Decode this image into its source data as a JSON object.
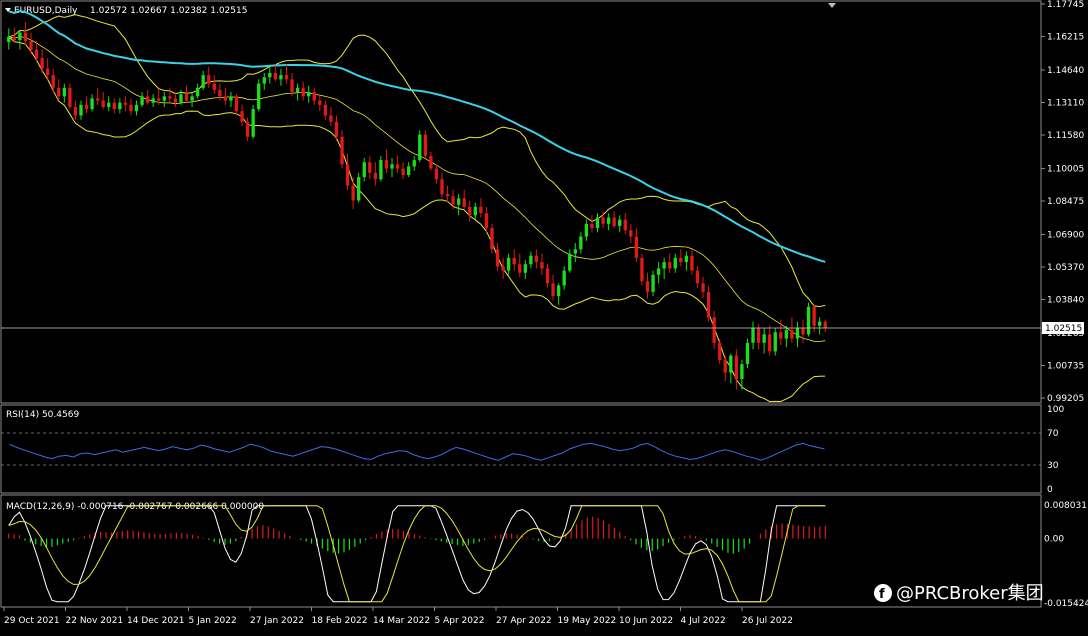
{
  "main_panel": {
    "symbol_title": "EURUSD,Daily",
    "ohlc": "1.02572 1.02667 1.02382 1.02515",
    "current_price_label": "1.02515",
    "price_axis_labels": [
      "1.17745",
      "1.16215",
      "1.14640",
      "1.13110",
      "1.11580",
      "1.10005",
      "1.08475",
      "1.06900",
      "1.05370",
      "1.03840",
      "1.02265",
      "1.00735",
      "0.99205"
    ],
    "candles": [
      [
        1.1595,
        1.166,
        1.156,
        1.162
      ],
      [
        1.162,
        1.1665,
        1.159,
        1.1605
      ],
      [
        1.1605,
        1.165,
        1.156,
        1.164
      ],
      [
        1.164,
        1.169,
        1.158,
        1.16
      ],
      [
        1.16,
        1.164,
        1.154,
        1.156
      ],
      [
        1.156,
        1.16,
        1.15,
        1.152
      ],
      [
        1.152,
        1.156,
        1.145,
        1.147
      ],
      [
        1.147,
        1.152,
        1.142,
        1.144
      ],
      [
        1.144,
        1.147,
        1.136,
        1.138
      ],
      [
        1.138,
        1.142,
        1.132,
        1.134
      ],
      [
        1.134,
        1.14,
        1.131,
        1.138
      ],
      [
        1.138,
        1.14,
        1.128,
        1.129
      ],
      [
        1.129,
        1.132,
        1.123,
        1.125
      ],
      [
        1.125,
        1.132,
        1.123,
        1.13
      ],
      [
        1.13,
        1.134,
        1.126,
        1.128
      ],
      [
        1.128,
        1.135,
        1.127,
        1.133
      ],
      [
        1.133,
        1.138,
        1.13,
        1.132
      ],
      [
        1.132,
        1.136,
        1.128,
        1.129
      ],
      [
        1.129,
        1.134,
        1.127,
        1.131
      ],
      [
        1.131,
        1.133,
        1.126,
        1.128
      ],
      [
        1.128,
        1.133,
        1.126,
        1.131
      ],
      [
        1.131,
        1.134,
        1.127,
        1.13
      ],
      [
        1.13,
        1.133,
        1.125,
        1.127
      ],
      [
        1.127,
        1.132,
        1.125,
        1.13
      ],
      [
        1.13,
        1.136,
        1.129,
        1.134
      ],
      [
        1.134,
        1.137,
        1.13,
        1.131
      ],
      [
        1.131,
        1.135,
        1.129,
        1.133
      ],
      [
        1.133,
        1.137,
        1.13,
        1.132
      ],
      [
        1.132,
        1.136,
        1.129,
        1.134
      ],
      [
        1.134,
        1.138,
        1.131,
        1.133
      ],
      [
        1.133,
        1.136,
        1.129,
        1.131
      ],
      [
        1.131,
        1.137,
        1.13,
        1.135
      ],
      [
        1.135,
        1.139,
        1.131,
        1.132
      ],
      [
        1.132,
        1.136,
        1.129,
        1.134
      ],
      [
        1.134,
        1.14,
        1.133,
        1.138
      ],
      [
        1.138,
        1.146,
        1.137,
        1.144
      ],
      [
        1.144,
        1.148,
        1.138,
        1.14
      ],
      [
        1.14,
        1.144,
        1.135,
        1.137
      ],
      [
        1.137,
        1.14,
        1.132,
        1.134
      ],
      [
        1.134,
        1.138,
        1.13,
        1.132
      ],
      [
        1.132,
        1.136,
        1.129,
        1.134
      ],
      [
        1.134,
        1.135,
        1.125,
        1.127
      ],
      [
        1.127,
        1.13,
        1.12,
        1.122
      ],
      [
        1.122,
        1.124,
        1.113,
        1.115
      ],
      [
        1.115,
        1.13,
        1.114,
        1.128
      ],
      [
        1.128,
        1.142,
        1.127,
        1.14
      ],
      [
        1.14,
        1.145,
        1.137,
        1.143
      ],
      [
        1.143,
        1.148,
        1.14,
        1.145
      ],
      [
        1.145,
        1.149,
        1.141,
        1.142
      ],
      [
        1.142,
        1.147,
        1.139,
        1.144
      ],
      [
        1.144,
        1.149,
        1.14,
        1.142
      ],
      [
        1.142,
        1.145,
        1.134,
        1.136
      ],
      [
        1.136,
        1.14,
        1.132,
        1.138
      ],
      [
        1.138,
        1.141,
        1.132,
        1.134
      ],
      [
        1.134,
        1.139,
        1.131,
        1.136
      ],
      [
        1.136,
        1.138,
        1.13,
        1.132
      ],
      [
        1.132,
        1.135,
        1.127,
        1.13
      ],
      [
        1.13,
        1.132,
        1.123,
        1.125
      ],
      [
        1.125,
        1.129,
        1.12,
        1.122
      ],
      [
        1.122,
        1.125,
        1.113,
        1.115
      ],
      [
        1.115,
        1.118,
        1.1,
        1.102
      ],
      [
        1.102,
        1.107,
        1.09,
        1.092
      ],
      [
        1.092,
        1.096,
        1.081,
        1.085
      ],
      [
        1.085,
        1.098,
        1.084,
        1.096
      ],
      [
        1.096,
        1.105,
        1.094,
        1.103
      ],
      [
        1.103,
        1.106,
        1.095,
        1.098
      ],
      [
        1.098,
        1.103,
        1.092,
        1.095
      ],
      [
        1.095,
        1.106,
        1.094,
        1.104
      ],
      [
        1.104,
        1.109,
        1.098,
        1.1
      ],
      [
        1.1,
        1.105,
        1.096,
        1.102
      ],
      [
        1.102,
        1.106,
        1.098,
        1.1
      ],
      [
        1.1,
        1.103,
        1.095,
        1.097
      ],
      [
        1.097,
        1.103,
        1.096,
        1.101
      ],
      [
        1.101,
        1.106,
        1.099,
        1.104
      ],
      [
        1.104,
        1.118,
        1.103,
        1.116
      ],
      [
        1.116,
        1.118,
        1.105,
        1.106
      ],
      [
        1.106,
        1.108,
        1.099,
        1.1
      ],
      [
        1.1,
        1.102,
        1.093,
        1.095
      ],
      [
        1.095,
        1.098,
        1.086,
        1.088
      ],
      [
        1.088,
        1.092,
        1.084,
        1.087
      ],
      [
        1.087,
        1.09,
        1.081,
        1.083
      ],
      [
        1.083,
        1.088,
        1.078,
        1.086
      ],
      [
        1.086,
        1.09,
        1.081,
        1.082
      ],
      [
        1.082,
        1.085,
        1.075,
        1.078
      ],
      [
        1.078,
        1.084,
        1.076,
        1.082
      ],
      [
        1.082,
        1.086,
        1.077,
        1.079
      ],
      [
        1.079,
        1.082,
        1.07,
        1.072
      ],
      [
        1.072,
        1.074,
        1.06,
        1.062
      ],
      [
        1.062,
        1.065,
        1.052,
        1.054
      ],
      [
        1.054,
        1.058,
        1.048,
        1.052
      ],
      [
        1.052,
        1.06,
        1.05,
        1.058
      ],
      [
        1.058,
        1.062,
        1.052,
        1.055
      ],
      [
        1.055,
        1.06,
        1.049,
        1.051
      ],
      [
        1.051,
        1.057,
        1.048,
        1.055
      ],
      [
        1.055,
        1.061,
        1.053,
        1.059
      ],
      [
        1.059,
        1.062,
        1.053,
        1.056
      ],
      [
        1.056,
        1.06,
        1.05,
        1.053
      ],
      [
        1.053,
        1.055,
        1.044,
        1.046
      ],
      [
        1.046,
        1.05,
        1.038,
        1.04
      ],
      [
        1.04,
        1.046,
        1.036,
        1.045
      ],
      [
        1.045,
        1.054,
        1.043,
        1.052
      ],
      [
        1.052,
        1.062,
        1.051,
        1.06
      ],
      [
        1.06,
        1.065,
        1.056,
        1.062
      ],
      [
        1.062,
        1.07,
        1.06,
        1.068
      ],
      [
        1.068,
        1.076,
        1.066,
        1.074
      ],
      [
        1.074,
        1.078,
        1.07,
        1.072
      ],
      [
        1.072,
        1.079,
        1.07,
        1.077
      ],
      [
        1.077,
        1.08,
        1.072,
        1.074
      ],
      [
        1.074,
        1.079,
        1.071,
        1.077
      ],
      [
        1.077,
        1.08,
        1.072,
        1.073
      ],
      [
        1.073,
        1.078,
        1.07,
        1.076
      ],
      [
        1.076,
        1.079,
        1.069,
        1.071
      ],
      [
        1.071,
        1.074,
        1.065,
        1.068
      ],
      [
        1.068,
        1.072,
        1.056,
        1.058
      ],
      [
        1.058,
        1.06,
        1.045,
        1.047
      ],
      [
        1.047,
        1.051,
        1.039,
        1.042
      ],
      [
        1.042,
        1.052,
        1.04,
        1.05
      ],
      [
        1.05,
        1.056,
        1.046,
        1.053
      ],
      [
        1.053,
        1.058,
        1.048,
        1.056
      ],
      [
        1.056,
        1.06,
        1.051,
        1.053
      ],
      [
        1.053,
        1.06,
        1.051,
        1.058
      ],
      [
        1.058,
        1.062,
        1.054,
        1.056
      ],
      [
        1.056,
        1.061,
        1.052,
        1.059
      ],
      [
        1.059,
        1.062,
        1.05,
        1.052
      ],
      [
        1.052,
        1.054,
        1.044,
        1.046
      ],
      [
        1.046,
        1.049,
        1.039,
        1.042
      ],
      [
        1.042,
        1.045,
        1.028,
        1.03
      ],
      [
        1.03,
        1.033,
        1.015,
        1.018
      ],
      [
        1.018,
        1.02,
        1.008,
        1.01
      ],
      [
        1.01,
        1.012,
        1.0,
        1.004
      ],
      [
        1.004,
        1.013,
        0.999,
        1.012
      ],
      [
        1.012,
        1.015,
        0.996,
        1.001
      ],
      [
        1.001,
        1.01,
        0.996,
        1.008
      ],
      [
        1.008,
        1.02,
        1.006,
        1.018
      ],
      [
        1.018,
        1.028,
        1.015,
        1.025
      ],
      [
        1.025,
        1.027,
        1.015,
        1.018
      ],
      [
        1.018,
        1.025,
        1.013,
        1.022
      ],
      [
        1.022,
        1.026,
        1.012,
        1.014
      ],
      [
        1.014,
        1.025,
        1.012,
        1.023
      ],
      [
        1.023,
        1.029,
        1.017,
        1.02
      ],
      [
        1.02,
        1.026,
        1.016,
        1.024
      ],
      [
        1.024,
        1.03,
        1.018,
        1.02
      ],
      [
        1.02,
        1.028,
        1.016,
        1.025
      ],
      [
        1.025,
        1.029,
        1.018,
        1.022
      ],
      [
        1.022,
        1.037,
        1.021,
        1.035
      ],
      [
        1.035,
        1.036,
        1.023,
        1.026
      ],
      [
        1.026,
        1.03,
        1.022,
        1.028
      ],
      [
        1.028,
        1.029,
        1.023,
        1.025
      ]
    ]
  },
  "rsi_panel": {
    "title": "RSI(14) 50.4569",
    "axis_labels": [
      "100",
      "70",
      "30",
      "0"
    ],
    "values": [
      56,
      52,
      49,
      46,
      43,
      40,
      38,
      41,
      42,
      40,
      44,
      45,
      43,
      45,
      47,
      49,
      46,
      48,
      50,
      52,
      50,
      48,
      50,
      53,
      51,
      49,
      51,
      55,
      53,
      50,
      48,
      46,
      49,
      52,
      56,
      54,
      51,
      47,
      45,
      43,
      41,
      44,
      47,
      50,
      53,
      52,
      50,
      47,
      44,
      41,
      38,
      37,
      41,
      44,
      46,
      48,
      47,
      43,
      40,
      38,
      40,
      43,
      48,
      52,
      50,
      47,
      44,
      41,
      38,
      36,
      40,
      44,
      43,
      41,
      38,
      36,
      39,
      42,
      45,
      50,
      53,
      56,
      57,
      55,
      53,
      50,
      48,
      49,
      51,
      55,
      57,
      53,
      48,
      44,
      41,
      39,
      37,
      38,
      41,
      44,
      47,
      49,
      47,
      44,
      41,
      39,
      36,
      39,
      43,
      47,
      51,
      55,
      57,
      54,
      52,
      50
    ]
  },
  "macd_panel": {
    "title": "MACD(12,26,9) -0.000716 -0.002767 0.002666 0.000000",
    "axis_labels": [
      "0.008031",
      "0.00",
      "-0.015424"
    ],
    "histogram": [
      0.0012,
      0.001,
      0.0008,
      -0.0005,
      -0.001,
      -0.0014,
      -0.0018,
      -0.0022,
      -0.002,
      -0.0016,
      -0.0012,
      -0.0008,
      -0.0004,
      0.0002,
      0.0006,
      0.001,
      0.0014,
      0.0016,
      0.0015,
      0.0014,
      0.0016,
      0.0018,
      0.002,
      0.0019,
      0.0017,
      0.0015,
      0.0013,
      0.0011,
      0.001,
      0.0011,
      0.0012,
      0.0014,
      0.0013,
      0.0011,
      0.0009,
      0.0006,
      0.0002,
      -0.0003,
      -0.0008,
      -0.0012,
      -0.0015,
      -0.0012,
      -0.0006,
      0.0004,
      0.0014,
      0.0024,
      0.003,
      0.0032,
      0.0029,
      0.0024,
      0.0018,
      0.0012,
      0.0006,
      0.0001,
      -0.0003,
      -0.0007,
      -0.0012,
      -0.0018,
      -0.0024,
      -0.003,
      -0.0034,
      -0.0036,
      -0.0033,
      -0.0027,
      -0.002,
      -0.0012,
      -0.0004,
      0.0004,
      0.0011,
      0.0017,
      0.0021,
      0.0023,
      0.0022,
      0.0019,
      0.0015,
      0.0011,
      0.0007,
      0.0003,
      -0.0001,
      -0.0004,
      -0.0007,
      -0.001,
      -0.0013,
      -0.0016,
      -0.0018,
      -0.0016,
      -0.0012,
      -0.0008,
      -0.0003,
      0.0002,
      0.0007,
      0.0011,
      0.0013,
      0.0012,
      0.001,
      0.0006,
      0.0002,
      -0.0002,
      -0.0006,
      -0.0008,
      -0.0006,
      -0.0002,
      0.0004,
      0.0012,
      0.0022,
      0.0034,
      0.0044,
      0.005,
      0.0052,
      0.0049,
      0.0043,
      0.0035,
      0.0026,
      0.0016,
      0.0006,
      -0.0004,
      -0.0014,
      -0.0022,
      -0.0028,
      -0.003,
      -0.0026,
      -0.0018,
      -0.001,
      -0.0004,
      0.0002,
      0.0006,
      0.0008,
      0.0006,
      0.0002,
      -0.0004,
      -0.0012,
      -0.002,
      -0.0028,
      -0.0034,
      -0.0036,
      -0.0032,
      -0.0024,
      -0.0012,
      0.0,
      0.0012,
      0.0022,
      0.003,
      0.0034,
      0.0036,
      0.0035,
      0.0033,
      0.0031,
      0.003,
      0.0029,
      0.0028,
      0.0029,
      0.003
    ]
  },
  "time_axis_labels": [
    "29 Oct 2021",
    "22 Nov 2021",
    "14 Dec 2021",
    "5 Jan 2022",
    "27 Jan 2022",
    "18 Feb 2022",
    "14 Mar 2022",
    "5 Apr 2022",
    "27 Apr 2022",
    "19 May 2022",
    "10 Jun 2022",
    "4 Jul 2022",
    "26 Jul 2022"
  ],
  "watermark": "@PRCBroker集团",
  "colors": {
    "bull": "#19e019",
    "bear": "#e01919",
    "bands": "#e8e83a",
    "ma": "#3ad2e8",
    "rsi": "#3a6ee8",
    "grid": "#8c8c8c",
    "axis_text": "#ffffff"
  }
}
